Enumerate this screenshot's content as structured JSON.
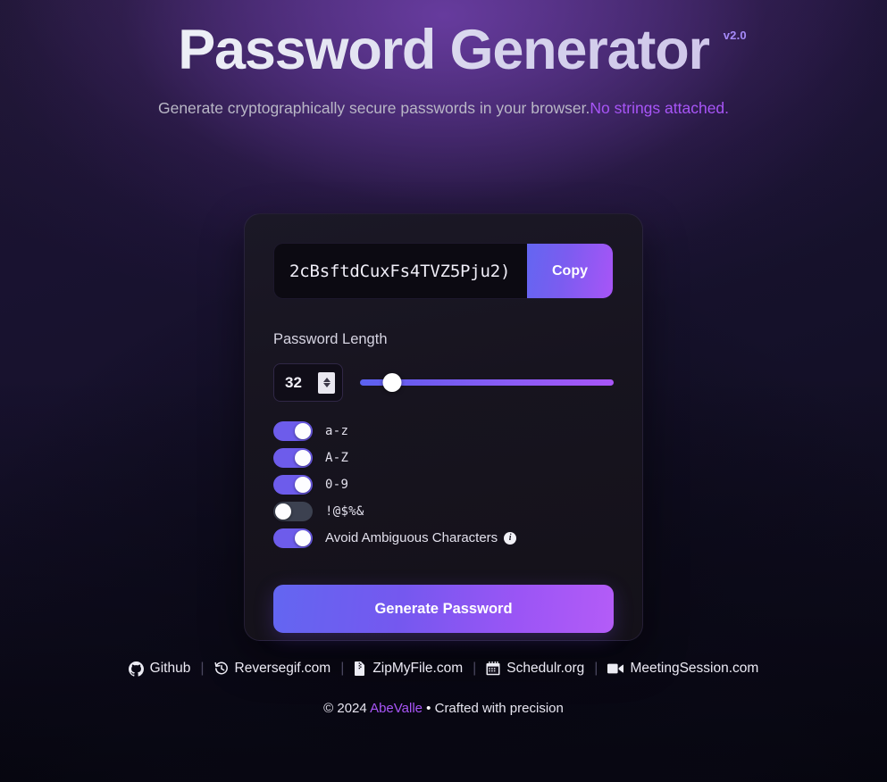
{
  "header": {
    "title": "Password Generator",
    "version_badge": "v2.0",
    "subtitle_main": "Generate cryptographically secure passwords in your browser.",
    "subtitle_accent": "No strings attached."
  },
  "generator": {
    "password_value": "2cBsftdCuxFs4TVZ5Pju2)",
    "copy_label": "Copy",
    "length_label": "Password Length",
    "length_value": "32",
    "slider_percent": 12.5,
    "options": [
      {
        "label": "a-z",
        "on": true,
        "mono": true,
        "name": "toggle-lowercase"
      },
      {
        "label": "A-Z",
        "on": true,
        "mono": true,
        "name": "toggle-uppercase"
      },
      {
        "label": "0-9",
        "on": true,
        "mono": true,
        "name": "toggle-numbers"
      },
      {
        "label": "!@$%&",
        "on": false,
        "mono": true,
        "name": "toggle-symbols"
      },
      {
        "label": "Avoid Ambiguous Characters",
        "on": true,
        "mono": false,
        "info": "i",
        "name": "toggle-avoid-ambiguous"
      }
    ],
    "generate_label": "Generate Password"
  },
  "footer": {
    "links": [
      {
        "label": "Github",
        "icon": "github-icon"
      },
      {
        "label": "Reversegif.com",
        "icon": "rotate-clock-icon"
      },
      {
        "label": "ZipMyFile.com",
        "icon": "file-zip-icon"
      },
      {
        "label": "Schedulr.org",
        "icon": "calendar-icon"
      },
      {
        "label": "MeetingSession.com",
        "icon": "video-camera-icon"
      }
    ],
    "separator": "|",
    "copyright_prefix": "© 2024 ",
    "copyright_name": "AbeValle",
    "copyright_bullet": " • ",
    "copyright_suffix": "Crafted with precision"
  },
  "colors": {
    "accent_purple": "#a855f7",
    "toggle_on": "#6d5ceb",
    "toggle_off": "#3c4150",
    "gradient_start": "#6366f1",
    "gradient_end": "#b45cf7",
    "card_bg": "#1b1826",
    "page_bg": "#120f20"
  }
}
